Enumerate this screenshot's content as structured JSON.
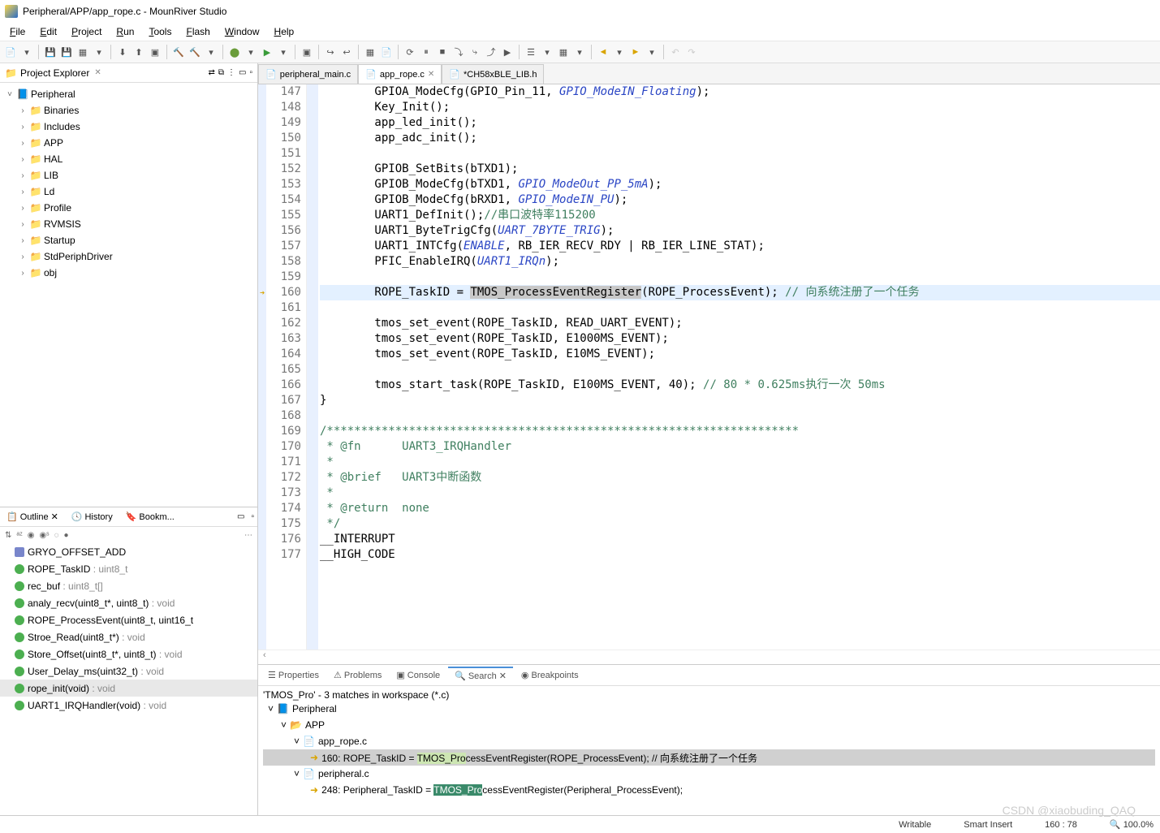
{
  "window": {
    "title": "Peripheral/APP/app_rope.c - MounRiver Studio"
  },
  "menu": [
    "File",
    "Edit",
    "Project",
    "Run",
    "Tools",
    "Flash",
    "Window",
    "Help"
  ],
  "project_explorer": {
    "title": "Project Explorer",
    "root": "Peripheral",
    "children": [
      "Binaries",
      "Includes",
      "APP",
      "HAL",
      "LIB",
      "Ld",
      "Profile",
      "RVMSIS",
      "Startup",
      "StdPeriphDriver",
      "obj"
    ]
  },
  "outline": {
    "tabs": [
      "Outline",
      "History",
      "Bookm..."
    ],
    "items": [
      {
        "icon": "def",
        "label": "GRYO_OFFSET_ADD",
        "type": ""
      },
      {
        "icon": "fn",
        "label": "ROPE_TaskID",
        "type": ": uint8_t"
      },
      {
        "icon": "fn",
        "label": "rec_buf",
        "type": ": uint8_t[]"
      },
      {
        "icon": "fn",
        "label": "analy_recv(uint8_t*, uint8_t)",
        "type": ": void"
      },
      {
        "icon": "fn",
        "label": "ROPE_ProcessEvent(uint8_t, uint16_t",
        "type": ""
      },
      {
        "icon": "fn",
        "label": "Stroe_Read(uint8_t*)",
        "type": ": void"
      },
      {
        "icon": "fn",
        "label": "Store_Offset(uint8_t*, uint8_t)",
        "type": ": void"
      },
      {
        "icon": "fn",
        "label": "User_Delay_ms(uint32_t)",
        "type": ": void"
      },
      {
        "icon": "fn",
        "label": "rope_init(void)",
        "type": ": void",
        "sel": true
      },
      {
        "icon": "fn",
        "label": "UART1_IRQHandler(void)",
        "type": ": void"
      }
    ]
  },
  "editor_tabs": [
    {
      "label": "peripheral_main.c"
    },
    {
      "label": "app_rope.c",
      "active": true
    },
    {
      "label": "*CH58xBLE_LIB.h"
    }
  ],
  "code_lines": [
    {
      "n": 147,
      "t": "        GPIOA_ModeCfg(GPIO_Pin_11, ",
      "m": "GPIO_ModeIN_Floating",
      "e": ");"
    },
    {
      "n": 148,
      "t": "        Key_Init();"
    },
    {
      "n": 149,
      "t": "        app_led_init();"
    },
    {
      "n": 150,
      "t": "        app_adc_init();"
    },
    {
      "n": 151,
      "t": ""
    },
    {
      "n": 152,
      "t": "        GPIOB_SetBits(bTXD1);"
    },
    {
      "n": 153,
      "t": "        GPIOB_ModeCfg(bTXD1, ",
      "m": "GPIO_ModeOut_PP_5mA",
      "e": ");"
    },
    {
      "n": 154,
      "t": "        GPIOB_ModeCfg(bRXD1, ",
      "m": "GPIO_ModeIN_PU",
      "e": ");"
    },
    {
      "n": 155,
      "t": "        UART1_DefInit();",
      "c": "//串口波特率115200"
    },
    {
      "n": 156,
      "t": "        UART1_ByteTrigCfg(",
      "m": "UART_7BYTE_TRIG",
      "e": ");"
    },
    {
      "n": 157,
      "t": "        UART1_INTCfg(",
      "m": "ENABLE",
      "e": ", RB_IER_RECV_RDY | RB_IER_LINE_STAT);"
    },
    {
      "n": 158,
      "t": "        PFIC_EnableIRQ(",
      "m": "UART1_IRQn",
      "e": ");"
    },
    {
      "n": 159,
      "t": ""
    },
    {
      "n": 160,
      "hl": true,
      "t": "        ROPE_TaskID = ",
      "sel": "TMOS_ProcessEventRegister",
      "e": "(ROPE_ProcessEvent); ",
      "c": "// 向系统注册了一个任务"
    },
    {
      "n": 161,
      "t": ""
    },
    {
      "n": 162,
      "t": "        tmos_set_event(ROPE_TaskID, READ_UART_EVENT);"
    },
    {
      "n": 163,
      "t": "        tmos_set_event(ROPE_TaskID, E1000MS_EVENT);"
    },
    {
      "n": 164,
      "t": "        tmos_set_event(ROPE_TaskID, E10MS_EVENT);"
    },
    {
      "n": 165,
      "t": ""
    },
    {
      "n": 166,
      "t": "        tmos_start_task(ROPE_TaskID, E100MS_EVENT, 40); ",
      "c": "// 80 * 0.625ms执行一次 50ms"
    },
    {
      "n": 167,
      "t": "}"
    },
    {
      "n": 168,
      "t": ""
    },
    {
      "n": 169,
      "c": "/*********************************************************************"
    },
    {
      "n": 170,
      "c": " * @fn      UART3_IRQHandler"
    },
    {
      "n": 171,
      "c": " *"
    },
    {
      "n": 172,
      "c": " * @brief   UART3中断函数"
    },
    {
      "n": 173,
      "c": " *"
    },
    {
      "n": 174,
      "c": " * @return  none"
    },
    {
      "n": 175,
      "c": " */"
    },
    {
      "n": 176,
      "t": "__INTERRUPT"
    },
    {
      "n": 177,
      "t": "__HIGH_CODE"
    }
  ],
  "bottom_tabs": [
    "Properties",
    "Problems",
    "Console",
    "Search",
    "Breakpoints"
  ],
  "search": {
    "summary": "'TMOS_Pro' - 3 matches in workspace (*.c)",
    "root": "Peripheral",
    "folder": "APP",
    "file1": "app_rope.c",
    "match1_pre": "160: ROPE_TaskID = ",
    "match1_hl": "TMOS_Pro",
    "match1_post": "cessEventRegister(ROPE_ProcessEvent); // 向系统注册了一个任务",
    "file2": "peripheral.c",
    "match2_pre": "248: Peripheral_TaskID = ",
    "match2_hl": "TMOS_Pro",
    "match2_post": "cessEventRegister(Peripheral_ProcessEvent);"
  },
  "status": {
    "mode": "Writable",
    "insert": "Smart Insert",
    "pos": "160 : 78",
    "zoom": "100.0%"
  },
  "watermark": "CSDN @xiaobuding_QAQ"
}
